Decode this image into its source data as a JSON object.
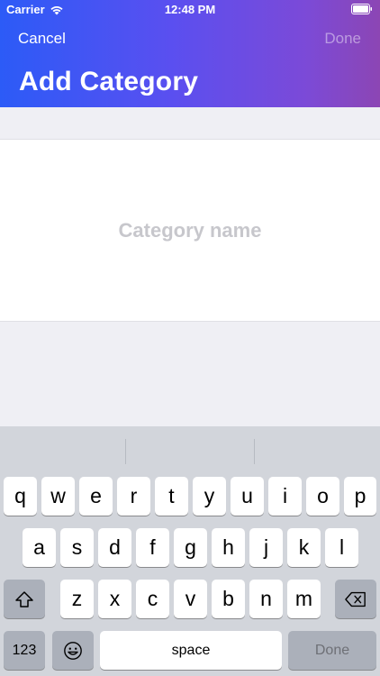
{
  "status_bar": {
    "carrier": "Carrier",
    "time": "12:48 PM",
    "wifi_icon": "wifi-icon",
    "battery_icon": "battery-icon"
  },
  "nav": {
    "cancel_label": "Cancel",
    "done_label": "Done",
    "title": "Add Category"
  },
  "form": {
    "category_placeholder": "Category name",
    "category_value": ""
  },
  "keyboard": {
    "row1": [
      "q",
      "w",
      "e",
      "r",
      "t",
      "y",
      "u",
      "i",
      "o",
      "p"
    ],
    "row2": [
      "a",
      "s",
      "d",
      "f",
      "g",
      "h",
      "j",
      "k",
      "l"
    ],
    "row3": [
      "z",
      "x",
      "c",
      "v",
      "b",
      "n",
      "m"
    ],
    "numbers_label": "123",
    "space_label": "space",
    "done_label": "Done",
    "shift_icon": "shift-icon",
    "delete_icon": "delete-icon",
    "emoji_icon": "emoji-icon"
  },
  "colors": {
    "header_gradient_start": "#2c5bf7",
    "header_gradient_end": "#8c46b4",
    "placeholder": "#c7c7cc",
    "keyboard_bg": "#d2d5db"
  }
}
